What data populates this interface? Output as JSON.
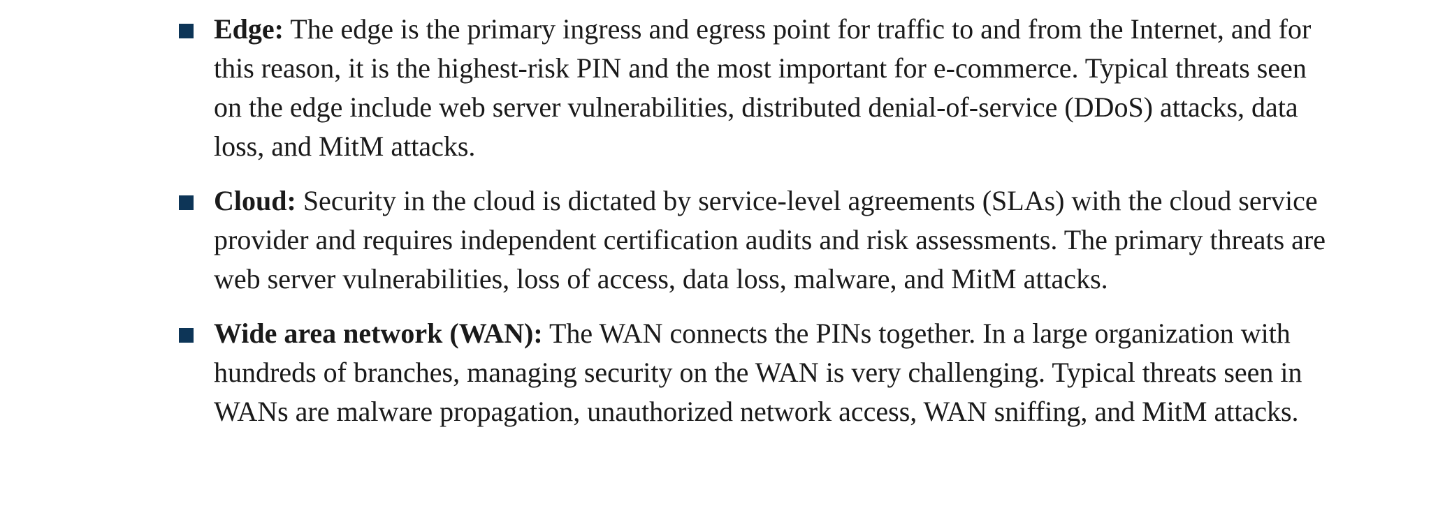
{
  "items": [
    {
      "term": "Edge:",
      "text": " The edge is the primary ingress and egress point for traffic to and from the Internet, and for this reason, it is the highest-risk PIN and the most important for e-commerce. Typical threats seen on the edge include web server vulnerabilities, distributed denial-of-service (DDoS) attacks, data loss, and MitM attacks."
    },
    {
      "term": "Cloud:",
      "text": " Security in the cloud is dictated by service-level agreements (SLAs) with the cloud service provider and requires independent certification audits and risk assessments. The primary threats are web server vulnerabilities, loss of access, data loss, malware, and MitM attacks."
    },
    {
      "term": "Wide area network (WAN):",
      "text": " The WAN connects the PINs together. In a large organization with hundreds of branches, managing security on the WAN is very challenging. Typical threats seen in WANs are malware propagation, unauthorized network access, WAN sniffing, and MitM attacks."
    }
  ],
  "colors": {
    "bullet": "#0d3557",
    "text": "#1a1a1a"
  }
}
